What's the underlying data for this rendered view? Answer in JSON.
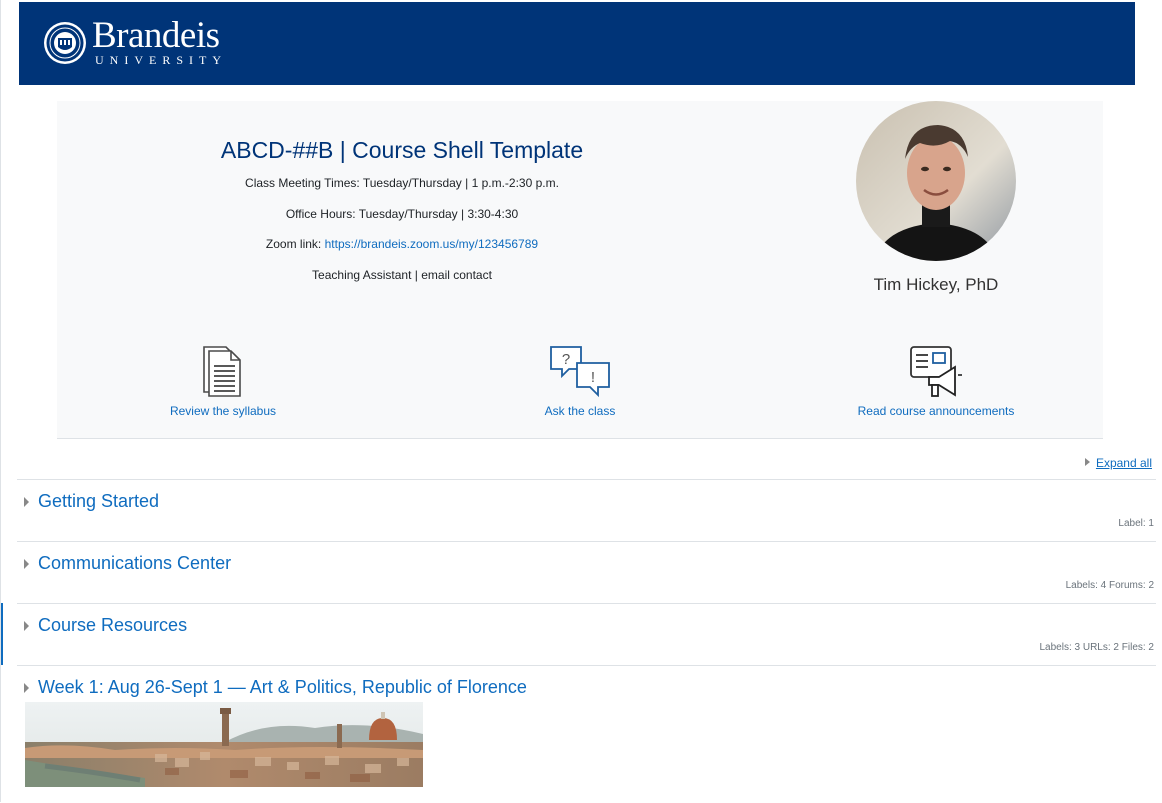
{
  "banner": {
    "logo_word": "Brandeis",
    "logo_sub": "UNIVERSITY",
    "bg": "#003478"
  },
  "course": {
    "title": "ABCD-##B | Course Shell Template",
    "meeting_times": "Class Meeting Times:  Tuesday/Thursday | 1 p.m.-2:30 p.m.",
    "office_hours": "Office Hours: Tuesday/Thursday | 3:30-4:30",
    "zoom_label": "Zoom link: ",
    "zoom_url": "https://brandeis.zoom.us/my/123456789",
    "ta_line": "Teaching Assistant | email contact"
  },
  "instructor": {
    "name": "Tim Hickey, PhD"
  },
  "quick_links": [
    {
      "label": "Review the syllabus",
      "icon": "document-icon"
    },
    {
      "label": "Ask the class",
      "icon": "speech-bubbles-icon"
    },
    {
      "label": "Read course announcements",
      "icon": "megaphone-icon"
    }
  ],
  "expand_all": "Expand all",
  "sections": [
    {
      "title": "Getting Started",
      "meta": "Label: 1"
    },
    {
      "title": "Communications Center",
      "meta": "Labels: 4  Forums: 2"
    },
    {
      "title": "Course Resources",
      "meta": "Labels: 3  URLs: 2  Files: 2"
    },
    {
      "title": "Week 1: Aug 26-Sept 1 — Art & Politics, Republic of Florence",
      "meta": ""
    }
  ],
  "colors": {
    "link": "#0f6cbf",
    "brand": "#003478",
    "hero_bg": "#f8f9fa"
  }
}
